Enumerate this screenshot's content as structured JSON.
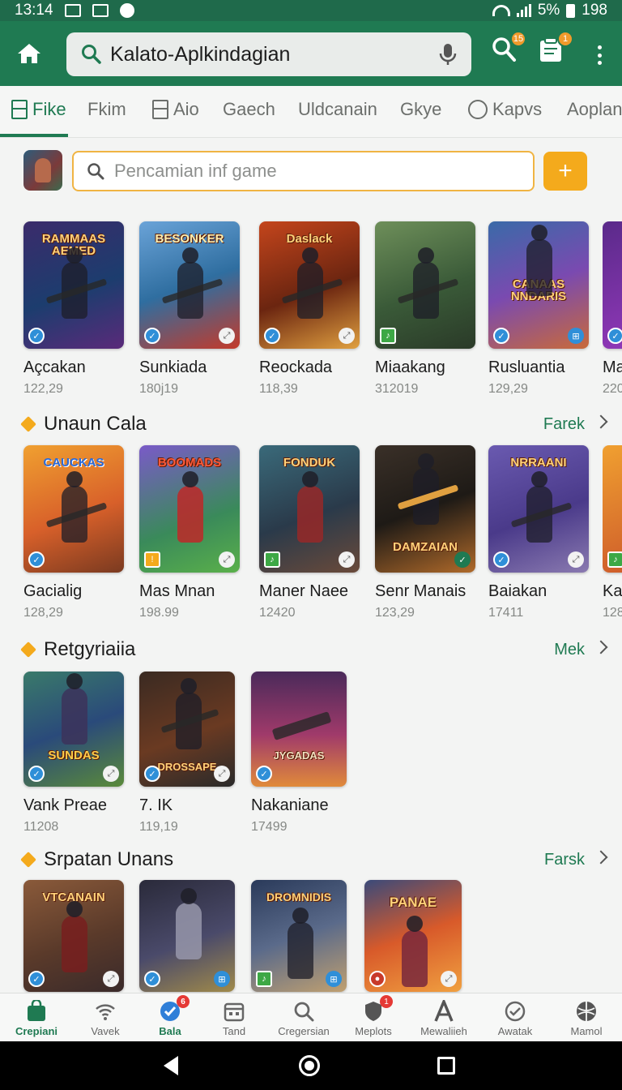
{
  "status_bar": {
    "time": "13:14",
    "battery_pct": "5%",
    "extra": "198"
  },
  "app_bar": {
    "search_text": "Kalato-Aplkindagian",
    "notif_count_1": "15",
    "notif_count_2": "1"
  },
  "tabs": [
    {
      "label": "Fike",
      "active": true
    },
    {
      "label": "Fkim"
    },
    {
      "label": "Aio"
    },
    {
      "label": "Gaech"
    },
    {
      "label": "Uldcanain"
    },
    {
      "label": "Gkye"
    },
    {
      "label": "Kapvs"
    },
    {
      "label": "Aoplana"
    }
  ],
  "game_search": {
    "placeholder": "Pencamian inf game",
    "add_label": "+"
  },
  "sections": [
    {
      "title": "",
      "items": [
        {
          "name": "Açcakan",
          "count": "122,29",
          "art_text": "RAMMAAS AEMED"
        },
        {
          "name": "Sunkiada",
          "count": "180j19",
          "art_text": "BESONKER"
        },
        {
          "name": "Reockada",
          "count": "118,39",
          "art_text": "Daslack"
        },
        {
          "name": "Miaakang",
          "count": "312019",
          "art_text": ""
        },
        {
          "name": "Rusluantia",
          "count": "129,29",
          "art_text": "CANAAS NNDARIS"
        },
        {
          "name": "Ma",
          "count": "220",
          "art_text": ""
        }
      ]
    },
    {
      "title": "Unaun Cala",
      "more": "Farek",
      "items": [
        {
          "name": "Gacialig",
          "count": "128,29",
          "art_text": "CAUCKAS"
        },
        {
          "name": "Mas Mnan",
          "count": "198.99",
          "art_text": "BOOMADS"
        },
        {
          "name": "Maner Naee",
          "count": "12420",
          "art_text": "FONDUK"
        },
        {
          "name": "Senr Manais",
          "count": "123,29",
          "art_text": "DAMZAIAN"
        },
        {
          "name": "Baiakan",
          "count": "17411",
          "art_text": "NRRAANI"
        },
        {
          "name": "Ka",
          "count": "128",
          "art_text": ""
        }
      ]
    },
    {
      "title": "Retgyriaiia",
      "more": "Mek",
      "items": [
        {
          "name": "Vank Preae",
          "count": "11208",
          "art_text": "SUNDAS"
        },
        {
          "name": "7. IK",
          "count": "119,19",
          "art_text": "DROSSAPE"
        },
        {
          "name": "Nakaniane",
          "count": "17499",
          "art_text": "JYGADAS"
        }
      ]
    },
    {
      "title": "Srpatan Unans",
      "more": "Farsk",
      "items": [
        {
          "name": "",
          "count": "",
          "art_text": "VTCANAIN"
        },
        {
          "name": "",
          "count": "",
          "art_text": ""
        },
        {
          "name": "",
          "count": "",
          "art_text": "DROMNIDIS"
        },
        {
          "name": "",
          "count": "",
          "art_text": "PANAE"
        }
      ]
    }
  ],
  "bottom_nav": [
    {
      "label": "Crepiani",
      "icon": "bag-icon",
      "active": true
    },
    {
      "label": "Vavek",
      "icon": "wifi-icon"
    },
    {
      "label": "Bala",
      "icon": "globe-icon",
      "badge": "6"
    },
    {
      "label": "Tand",
      "icon": "calendar-icon"
    },
    {
      "label": "Cregersian",
      "icon": "search-icon"
    },
    {
      "label": "Meplots",
      "icon": "shield-icon",
      "badge": "1"
    },
    {
      "label": "Mewaliieh",
      "icon": "letter-a-icon"
    },
    {
      "label": "Awatak",
      "icon": "check-circle-icon"
    },
    {
      "label": "Mamol",
      "icon": "ball-icon"
    }
  ],
  "colors": {
    "primary": "#1f7a52",
    "accent": "#f4aa1c",
    "status_bar": "#1f6a4b"
  }
}
